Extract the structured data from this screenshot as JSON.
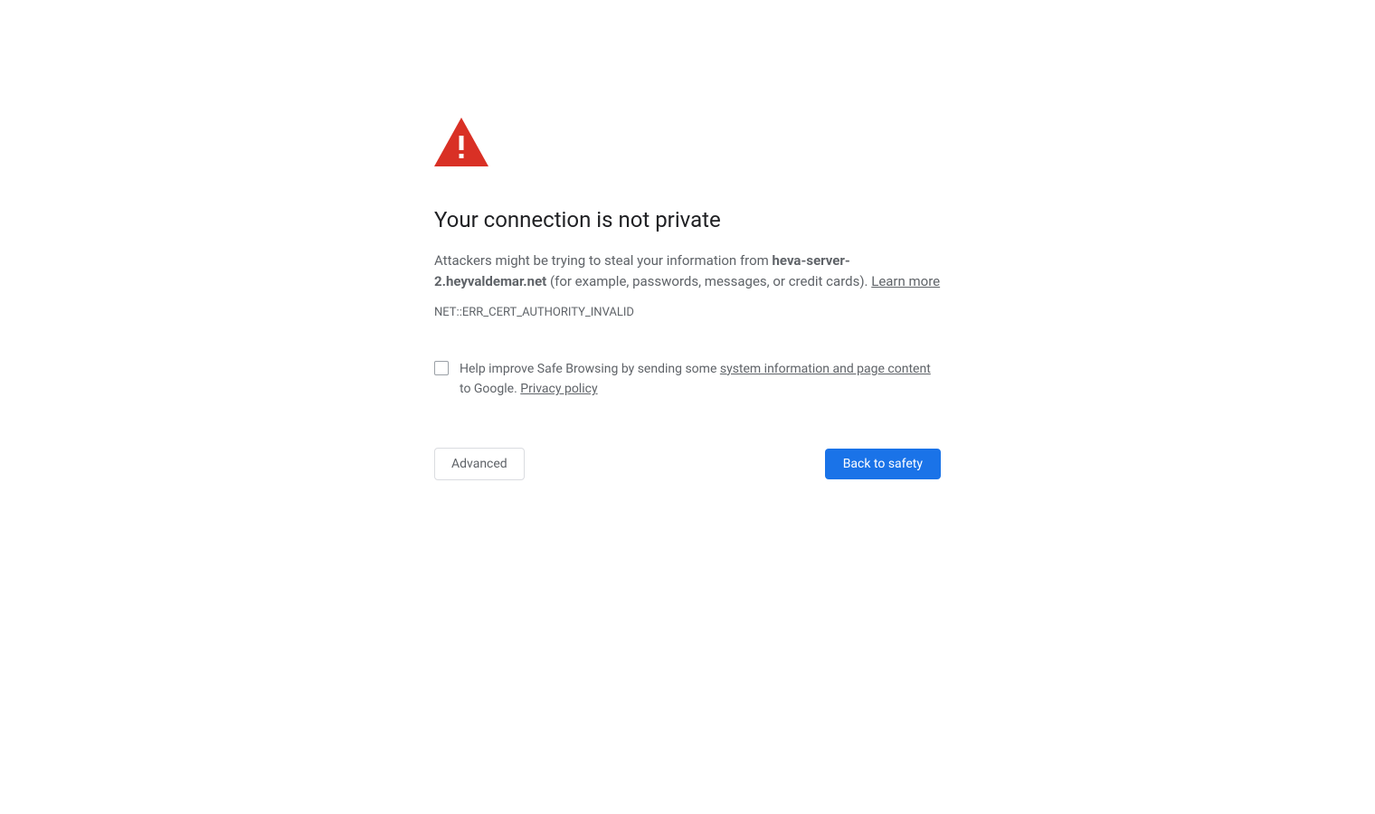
{
  "warning": {
    "title": "Your connection is not private",
    "description_prefix": "Attackers might be trying to steal your information from ",
    "hostname": "heva-server-2.heyvaldemar.net",
    "description_suffix": " (for example, passwords, messages, or credit cards). ",
    "learn_more": "Learn more",
    "error_code": "NET::ERR_CERT_AUTHORITY_INVALID"
  },
  "checkbox": {
    "text_prefix": "Help improve Safe Browsing by sending some ",
    "link1": "system information and page content",
    "text_middle": " to Google. ",
    "link2": "Privacy policy"
  },
  "buttons": {
    "advanced": "Advanced",
    "back_to_safety": "Back to safety"
  },
  "colors": {
    "icon_red": "#d93025",
    "primary_blue": "#1a73e8",
    "text_primary": "#202124",
    "text_secondary": "#5f6368"
  }
}
